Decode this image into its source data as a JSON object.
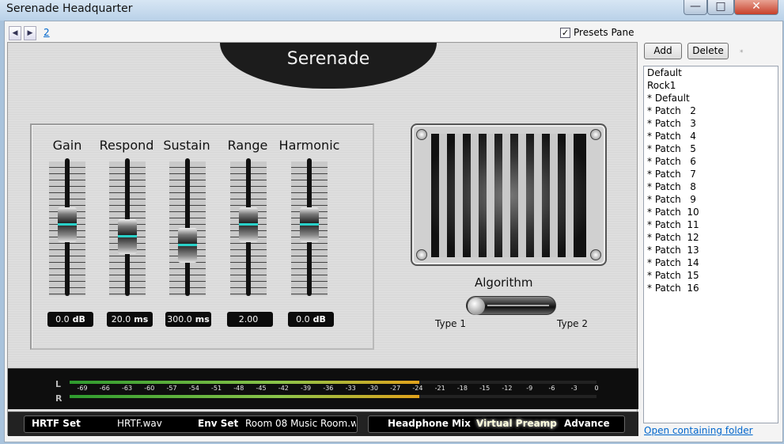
{
  "window": {
    "title": "Serenade Headquarter",
    "minimize": "—",
    "maximize": "□",
    "close": "✕"
  },
  "nav": {
    "back": "◀",
    "forward": "▶",
    "page": "2"
  },
  "presets_pane": {
    "label": "Presets Pane",
    "checked": true,
    "check": "✓"
  },
  "plugin": {
    "logo": "Serenade",
    "faders": [
      {
        "label": "Gain",
        "value": "0.0",
        "unit": "dB",
        "level": 0.52
      },
      {
        "label": "Respond",
        "value": "20.0",
        "unit": "ms",
        "level": 0.41
      },
      {
        "label": "Sustain",
        "value": "300.0",
        "unit": "ms",
        "level": 0.32
      },
      {
        "label": "Range",
        "value": "2.00",
        "unit": "",
        "level": 0.52
      },
      {
        "label": "Harmonic",
        "value": "0.0",
        "unit": "dB",
        "level": 0.52
      }
    ],
    "algorithm": {
      "label": "Algorithm",
      "left": "Type 1",
      "right": "Type 2",
      "value": "Type 1"
    },
    "meter": {
      "left_label": "L",
      "right_label": "R",
      "scale": [
        "-69",
        "-66",
        "-63",
        "-60",
        "-57",
        "-54",
        "-51",
        "-48",
        "-45",
        "-42",
        "-39",
        "-36",
        "-33",
        "-30",
        "-27",
        "-24",
        "-21",
        "-18",
        "-15",
        "-12",
        "-9",
        "-6",
        "-3",
        "0"
      ],
      "level_l": -24,
      "level_r": -24
    },
    "bottom": {
      "hrtf_label": "HRTF Set",
      "hrtf_value": "HRTF.wav",
      "env_label": "Env Set",
      "env_value": "Room 08 Music Room.wa",
      "headphone_mix": "Headphone Mix",
      "virtual_preamp": "Virtual Preamp",
      "advance": "Advance"
    }
  },
  "side": {
    "add": "Add",
    "delete": "Delete",
    "star": "*",
    "items": [
      "Default",
      "Rock1",
      "* Default",
      "* Patch   2",
      "* Patch   3",
      "* Patch   4",
      "* Patch   5",
      "* Patch   6",
      "* Patch   7",
      "* Patch   8",
      "* Patch   9",
      "* Patch  10",
      "* Patch  11",
      "* Patch  12",
      "* Patch  13",
      "* Patch  14",
      "* Patch  15",
      "* Patch  16"
    ],
    "open_folder": "Open containing folder"
  },
  "colors": {
    "accent_knob": "#29d0c8",
    "link": "#0066cc",
    "meter_green": "#2e9a2e",
    "meter_amber": "#e2a21b"
  }
}
